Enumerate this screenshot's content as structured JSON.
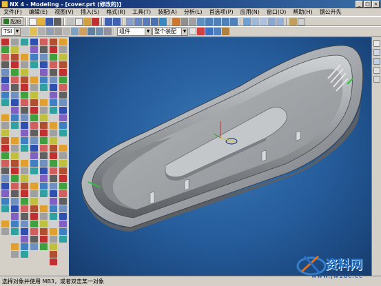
{
  "window": {
    "title": "NX 4 - Modeling - [cover.prt (修改的)]",
    "controls": [
      "_",
      "□",
      "×"
    ]
  },
  "menu": [
    "文件(F)",
    "编辑(E)",
    "视图(V)",
    "插入(S)",
    "格式(R)",
    "工具(T)",
    "装配(A)",
    "分析(L)",
    "首选项(P)",
    "应用(N)",
    "窗口(O)",
    "帮助(H)",
    "钢公升先"
  ],
  "toolbar": {
    "start_label": "起始",
    "layer_combo": "TSI",
    "filter_combo": "组件",
    "assembly_combo": "整个装配"
  },
  "status": {
    "message": "选择对象并使用 MB3，或者双击某一对象"
  },
  "watermark": {
    "brand": "资料网",
    "url": "www.jw1ac.cc"
  },
  "colors": {
    "viewport_bg": "#245a98",
    "title_bar": "#0a246a",
    "model_shell": "#a8acb0"
  }
}
